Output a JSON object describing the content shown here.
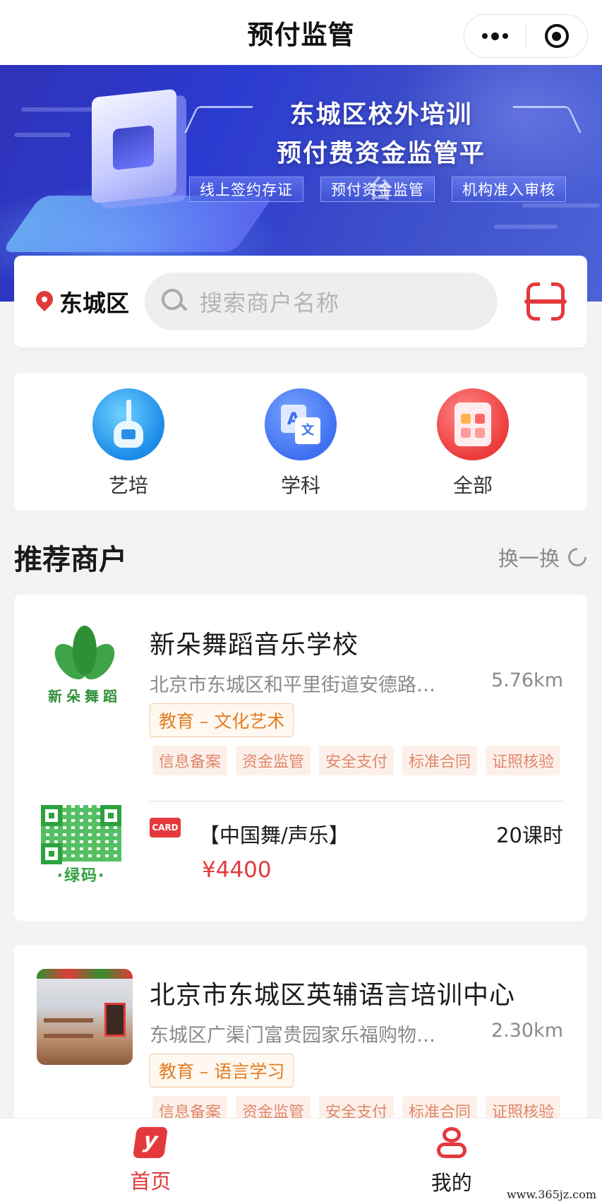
{
  "nav": {
    "title": "预付监管",
    "more_icon": "more-dots-icon",
    "close_icon": "capsule-target-icon"
  },
  "banner": {
    "title_line1": "东城区校外培训",
    "title_line2": "预付费资金监管平台",
    "tags": [
      "线上签约存证",
      "预付资金监管",
      "机构准入审核"
    ],
    "colors": {
      "start": "#2f33b8",
      "end": "#4c63d6"
    }
  },
  "search": {
    "district": "东城区",
    "placeholder": "搜索商户名称",
    "location_icon": "location-pin-icon",
    "search_icon": "search-icon",
    "scan_icon": "scan-icon"
  },
  "categories": [
    {
      "label": "艺培",
      "icon": "guitar-icon"
    },
    {
      "label": "学科",
      "icon": "translate-icon"
    },
    {
      "label": "全部",
      "icon": "grid-apps-icon"
    }
  ],
  "recommend": {
    "title": "推荐商户",
    "refresh_label": "换一换"
  },
  "merchants": [
    {
      "name": "新朵舞蹈音乐学校",
      "logo_text": "新朵舞蹈",
      "address": "北京市东城区和平里街道安德路…",
      "distance": "5.76km",
      "category": "教育 – 文化艺术",
      "tags": [
        "信息备案",
        "资金监管",
        "安全支付",
        "标准合同",
        "证照核验"
      ],
      "qr_label": "·绿码·",
      "card_badge": "CARD",
      "course": "【中国舞/声乐】",
      "hours": "20课时",
      "price": "¥4400"
    },
    {
      "name": "北京市东城区英辅语言培训中心",
      "address": "东城区广渠门富贵园家乐福购物…",
      "distance": "2.30km",
      "category": "教育 – 语言学习",
      "tags": [
        "信息备案",
        "资金监管",
        "安全支付",
        "标准合同",
        "证照核验"
      ]
    }
  ],
  "tabbar": {
    "home_label": "首页",
    "me_label": "我的",
    "active": "首页",
    "accent": "#e4393c"
  },
  "watermark": "www.365jz.com"
}
